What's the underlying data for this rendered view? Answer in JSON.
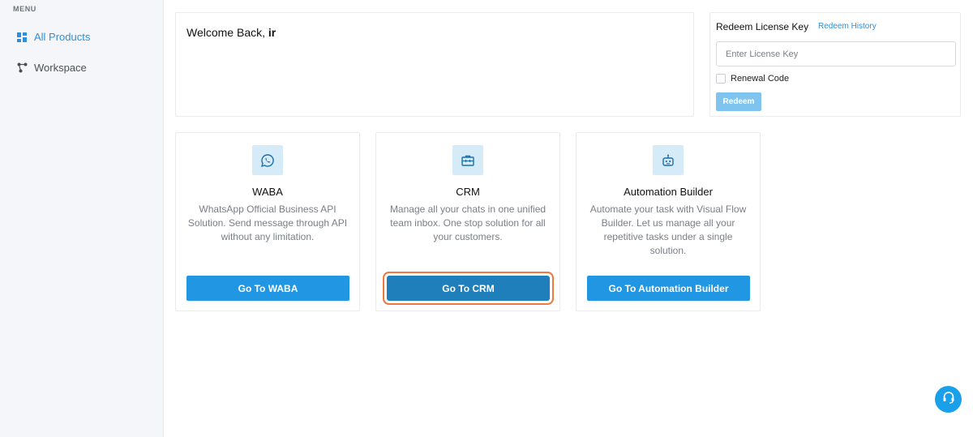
{
  "sidebar": {
    "menu_title": "MENU",
    "items": [
      {
        "label": "All Products",
        "icon": "grid-icon",
        "active": true
      },
      {
        "label": "Workspace",
        "icon": "nodes-icon",
        "active": false
      }
    ]
  },
  "welcome": {
    "prefix": "Welcome Back, ",
    "name": "ir"
  },
  "redeem": {
    "title": "Redeem License Key",
    "history_link": "Redeem History",
    "placeholder": "Enter License Key",
    "renewal_label": "Renewal Code",
    "button": "Redeem"
  },
  "products": [
    {
      "icon": "whatsapp-icon",
      "title": "WABA",
      "description": "WhatsApp Official Business API Solution. Send message through API without any limitation.",
      "button": "Go To WABA"
    },
    {
      "icon": "briefcase-icon",
      "title": "CRM",
      "description": "Manage all your chats in one unified team inbox. One stop solution for all your customers.",
      "button": "Go To CRM"
    },
    {
      "icon": "robot-icon",
      "title": "Automation Builder",
      "description": "Automate your task with Visual Flow Builder. Let us manage all your repetitive tasks under a single solution.",
      "button": "Go To Automation Builder"
    }
  ],
  "colors": {
    "accent": "#2196e3",
    "active_nav": "#2f8fd8",
    "focus_ring": "#f07a3c",
    "help_button": "#1aa0e8"
  }
}
